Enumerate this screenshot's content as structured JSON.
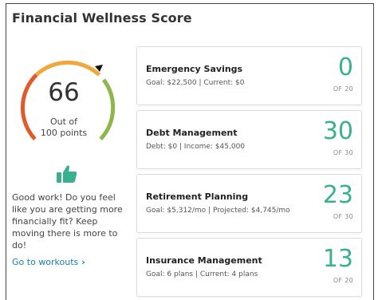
{
  "page": {
    "title": "Financial Wellness Score"
  },
  "gauge": {
    "score": "66",
    "out_of_line1": "Out of",
    "out_of_line2": "100 points",
    "fraction": 0.66,
    "colors": [
      "#e05a2b",
      "#f2a73b",
      "#8cb84a"
    ]
  },
  "sidebar": {
    "thumb_icon": "thumbs-up-icon",
    "thumb_color": "#3bb08f",
    "message": "Good work! Do you feel like you are getting more financially fit? Keep moving there is more to do!",
    "link_label": "Go to workouts",
    "link_chevron": "›"
  },
  "cards": [
    {
      "title": "Emergency Savings",
      "subtitle": "Goal: $22,500 | Current: $0",
      "value": "0",
      "of": "OF 20"
    },
    {
      "title": "Debt Management",
      "subtitle": "Debt: $0 | Income:  $45,000",
      "value": "30",
      "of": "OF 30"
    },
    {
      "title": "Retirement Planning",
      "subtitle": "Goal: $5,312/mo | Projected: $4,745/mo",
      "value": "23",
      "of": "OF 30"
    },
    {
      "title": "Insurance Management",
      "subtitle": "Goal: 6 plans | Current: 4 plans",
      "value": "13",
      "of": "OF 20"
    }
  ],
  "accent_color": "#3bb08f"
}
